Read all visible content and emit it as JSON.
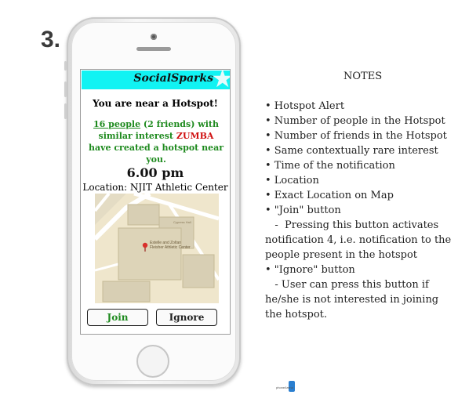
{
  "step_number": "3.",
  "phone_screen": {
    "app_title": "SocialSparks",
    "headline": "You are near a Hotspot!",
    "description": {
      "people_link": "16 people",
      "friends": "(2 friends)",
      "middle": " with similar interest ",
      "interest": "ZUMBA",
      "end": " have created a hotspot near you."
    },
    "time": "6.00 pm",
    "location": "Location: NJIT Athletic Center",
    "map": {
      "marker_label_line1": "Estelle and Zoltan",
      "marker_label_line2": "Fleisher Athletic Center",
      "hall_label": "Cypress Hall"
    },
    "join_label": "Join",
    "ignore_label": "Ignore"
  },
  "notes": {
    "title": "NOTES",
    "items": [
      "• Hotspot Alert",
      "• Number of people in the Hotspot",
      "• Number of friends in the Hotspot",
      "• Same contextually rare interest",
      "• Time of the notification",
      "• Location",
      "• Exact Location on Map",
      "• \"Join\" button",
      "   -  Pressing this button activates",
      "notification 4, i.e. notification to the",
      "people present in the hotspot",
      "• \"Ignore\" button",
      "   - User can press this button if",
      "he/she is not interested in joining",
      "the hotspot."
    ]
  },
  "watermark": "phoneArena"
}
